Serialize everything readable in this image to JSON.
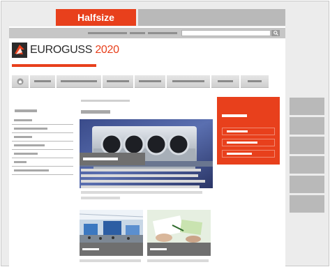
{
  "tabs": {
    "active_label": "Halfsize"
  },
  "logo": {
    "name": "EUROGUSS",
    "year": "2020"
  },
  "colors": {
    "accent": "#e8401c",
    "placeholder_grey": "#b9b9b9",
    "nav_grey": "#d6d6d6"
  },
  "icons": {
    "home": "home-icon",
    "search": "search-icon"
  },
  "nav": {
    "home_icon": "home-icon",
    "item_count": 8
  },
  "sidebar": {
    "item_count": 8
  },
  "teaser": {
    "link_count": 3
  },
  "right_column": {
    "block_count": 6
  }
}
